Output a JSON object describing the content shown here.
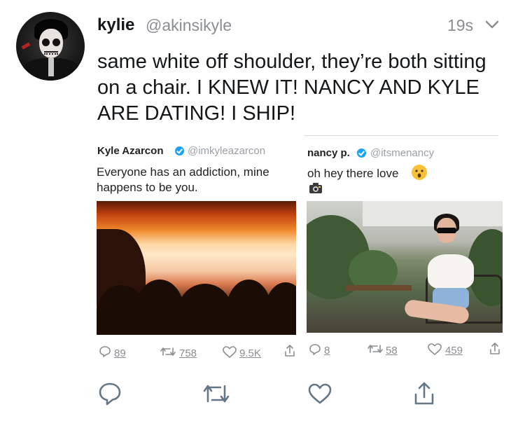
{
  "tweet": {
    "author_name": "kylie",
    "author_handle": "@akinsikyle",
    "time": "19s",
    "text": "same white off shoulder, they’re both sitting on a chair. I KNEW IT! NANCY AND KYLE ARE DATING! I SHIP!"
  },
  "left_card": {
    "name": "Kyle Azarcon",
    "handle": "@imkyleazarcon",
    "text_line1": "Everyone has an addiction, mine",
    "text_line2": "happens to be you.",
    "replies": "89",
    "retweets": "758",
    "likes": "9.5K"
  },
  "right_card": {
    "name": "nancy p.",
    "handle": "@itsmenancy",
    "text": "oh hey there love",
    "replies": "8",
    "retweets": "58",
    "likes": "459"
  },
  "icons": {
    "verified": "verified-badge-icon",
    "reply": "reply-icon",
    "retweet": "retweet-icon",
    "like": "heart-icon",
    "share": "share-icon",
    "more": "chevron-down-icon"
  },
  "colors": {
    "text": "#14171a",
    "muted": "#8a8d91",
    "verified": "#1da1f2"
  }
}
